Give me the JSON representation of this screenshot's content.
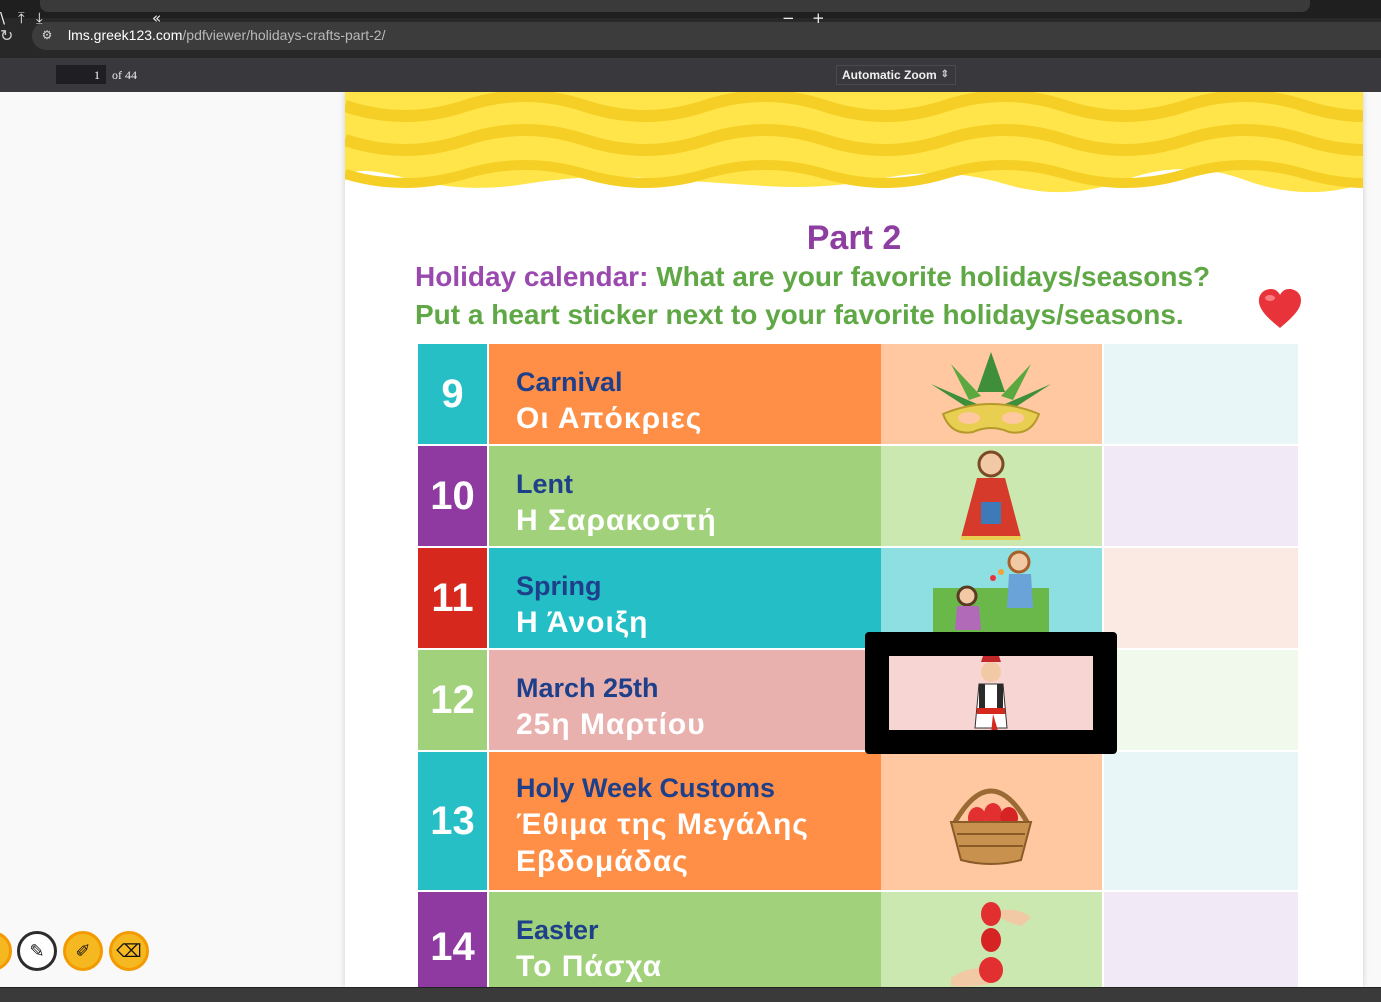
{
  "browser": {
    "url_host": "lms.greek123.com",
    "url_path": "/pdfviewer/holidays-crafts-part-2/"
  },
  "pdf_toolbar": {
    "page_number": "1",
    "page_count": "of 44",
    "zoom": "Automatic Zoom"
  },
  "page": {
    "title": "Part 2",
    "line1_label": "Holiday calendar:",
    "line1_rest": "What are your favorite holidays/seasons?",
    "line2": "Put a heart sticker next to your favorite holidays/seasons."
  },
  "calendar": [
    {
      "num": "9",
      "en": "Carnival",
      "gr": "Οι Απόκριες",
      "picture": "carnival-mask"
    },
    {
      "num": "10",
      "en": "Lent",
      "gr": "Η Σαρακοστή",
      "picture": "lent-girl-costume"
    },
    {
      "num": "11",
      "en": "Spring",
      "gr": "Η Άνοιξη",
      "picture": "spring-children"
    },
    {
      "num": "12",
      "en": "March 25th",
      "gr": "25η Μαρτίου",
      "picture": "evzone-boy"
    },
    {
      "num": "13",
      "en": "Holy Week Customs",
      "gr": "Έθιμα της Μεγάλης Εβδομάδας",
      "picture": "red-egg-basket"
    },
    {
      "num": "14",
      "en": "Easter",
      "gr": "Το Πάσχα",
      "picture": "egg-tapping-hands"
    }
  ],
  "colors": {
    "teal": "#26bfc6",
    "purple": "#8e3aa0",
    "red": "#d6281d",
    "green": "#a1d17a",
    "orange": "#ff8f47",
    "pink": "#e9b1ae"
  },
  "annotation_tools": [
    "pen-icon",
    "highlighter-icon",
    "eraser-icon"
  ]
}
